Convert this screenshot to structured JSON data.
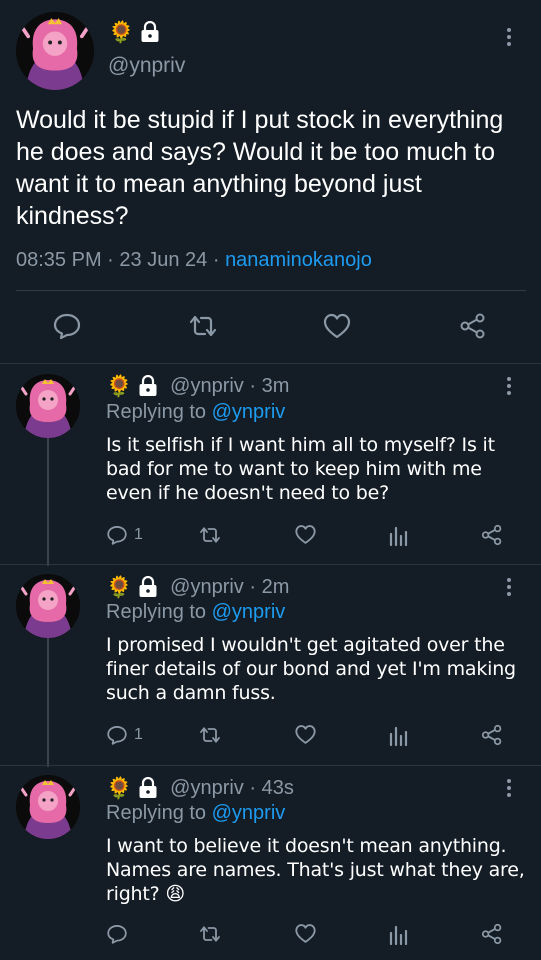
{
  "main": {
    "author_emojis": "🌻",
    "handle": "@ynpriv",
    "text": "Would it be stupid if I put stock in everything he does and says? Would it be too much to want it to mean anything beyond just kindness?",
    "time": "08:35 PM",
    "date": "23 Jun 24",
    "separator": "·",
    "via": "nanaminokanojo"
  },
  "replies": [
    {
      "emoji": "🌻",
      "handle": "@ynpriv · 3m",
      "replying_label": "Replying to",
      "replying_to": "@ynpriv",
      "text": "Is it selfish if I want him all to myself? Is it bad for me to want to keep him with me even if he doesn't need to be?",
      "reply_count": "1"
    },
    {
      "emoji": "🌻",
      "handle": "@ynpriv · 2m",
      "replying_label": "Replying to",
      "replying_to": "@ynpriv",
      "text": "I promised I wouldn't get agitated over the finer details of our bond and yet I'm making such a damn fuss.",
      "reply_count": "1"
    },
    {
      "emoji": "🌻",
      "handle": "@ynpriv · 43s",
      "replying_label": "Replying to",
      "replying_to": "@ynpriv",
      "text": "I want to believe it doesn't mean anything. Names are names. That's just what they are, right? 😩",
      "reply_count": ""
    }
  ],
  "icons": {
    "reply": "reply-icon",
    "retweet": "retweet-icon",
    "like": "like-icon",
    "share": "share-icon",
    "analytics": "analytics-icon",
    "more": "more-icon",
    "lock": "lock-icon"
  },
  "colors": {
    "background": "#141d26",
    "accent": "#1d9bf0",
    "muted": "#8b98a5"
  }
}
